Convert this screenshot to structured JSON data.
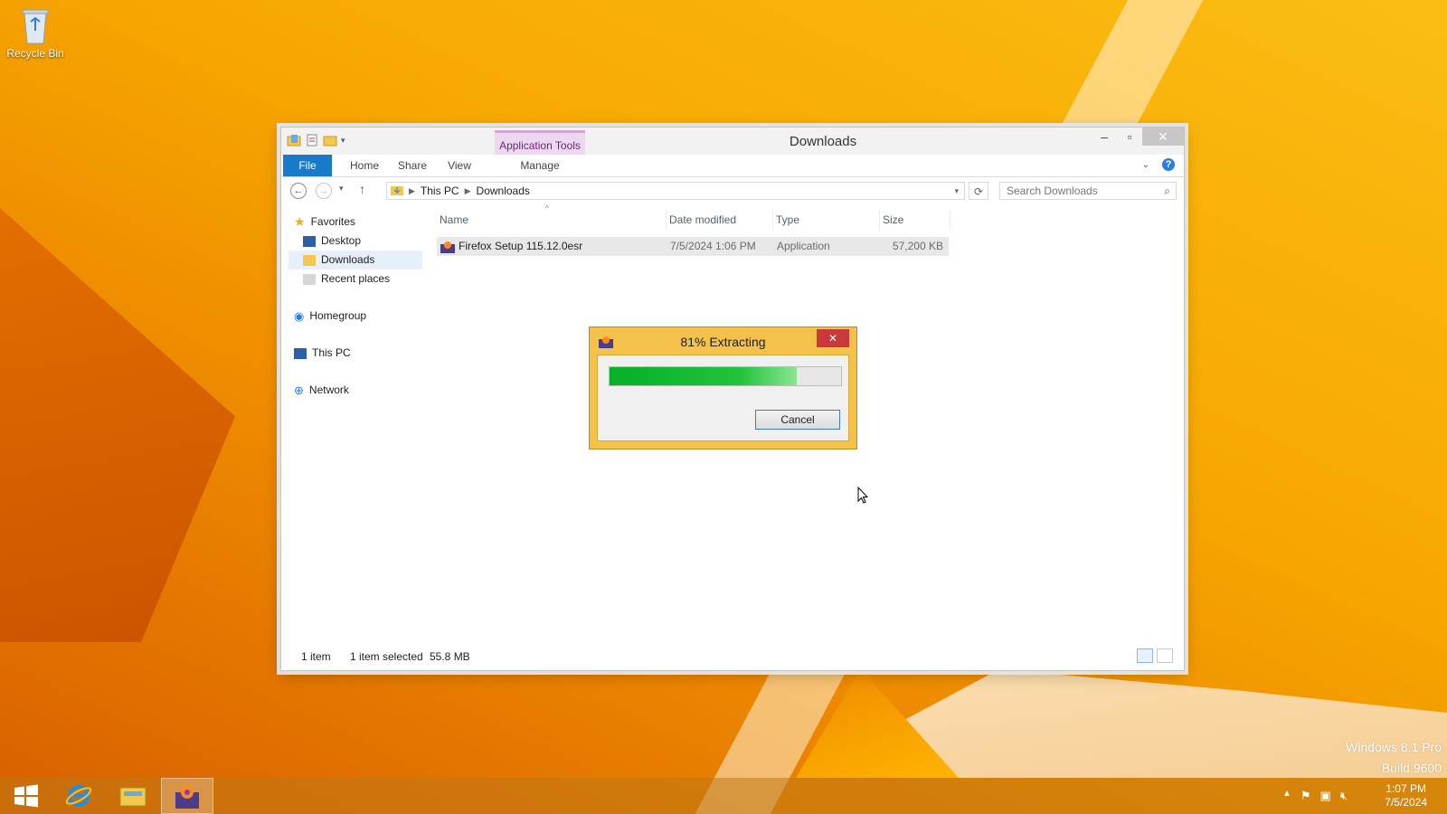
{
  "desktop": {
    "recycle_bin_label": "Recycle Bin"
  },
  "window": {
    "title": "Downloads",
    "contextual_tab": "Application Tools",
    "ribbon_tabs": [
      "File",
      "Home",
      "Share",
      "View",
      "Manage"
    ],
    "breadcrumb": [
      "This PC",
      "Downloads"
    ],
    "search_placeholder": "Search Downloads"
  },
  "nav_pane": {
    "favorites": "Favorites",
    "desktop": "Desktop",
    "downloads": "Downloads",
    "recent": "Recent places",
    "homegroup": "Homegroup",
    "this_pc": "This PC",
    "network": "Network"
  },
  "file_list": {
    "columns": [
      "Name",
      "Date modified",
      "Type",
      "Size"
    ],
    "rows": [
      {
        "name": "Firefox Setup 115.12.0esr",
        "date": "7/5/2024 1:06 PM",
        "type": "Application",
        "size": "57,200 KB"
      }
    ]
  },
  "status_bar": {
    "count": "1 item",
    "selected": "1 item selected",
    "size": "55.8 MB"
  },
  "dialog": {
    "title": "81% Extracting",
    "progress": 0.81,
    "cancel_label": "Cancel",
    "progress_color": "#06b025"
  },
  "taskbar": {
    "time": "1:07 PM",
    "date": "7/5/2024"
  },
  "watermark": {
    "line1": "Windows 8.1 Pro",
    "line2": "Build 9600"
  }
}
